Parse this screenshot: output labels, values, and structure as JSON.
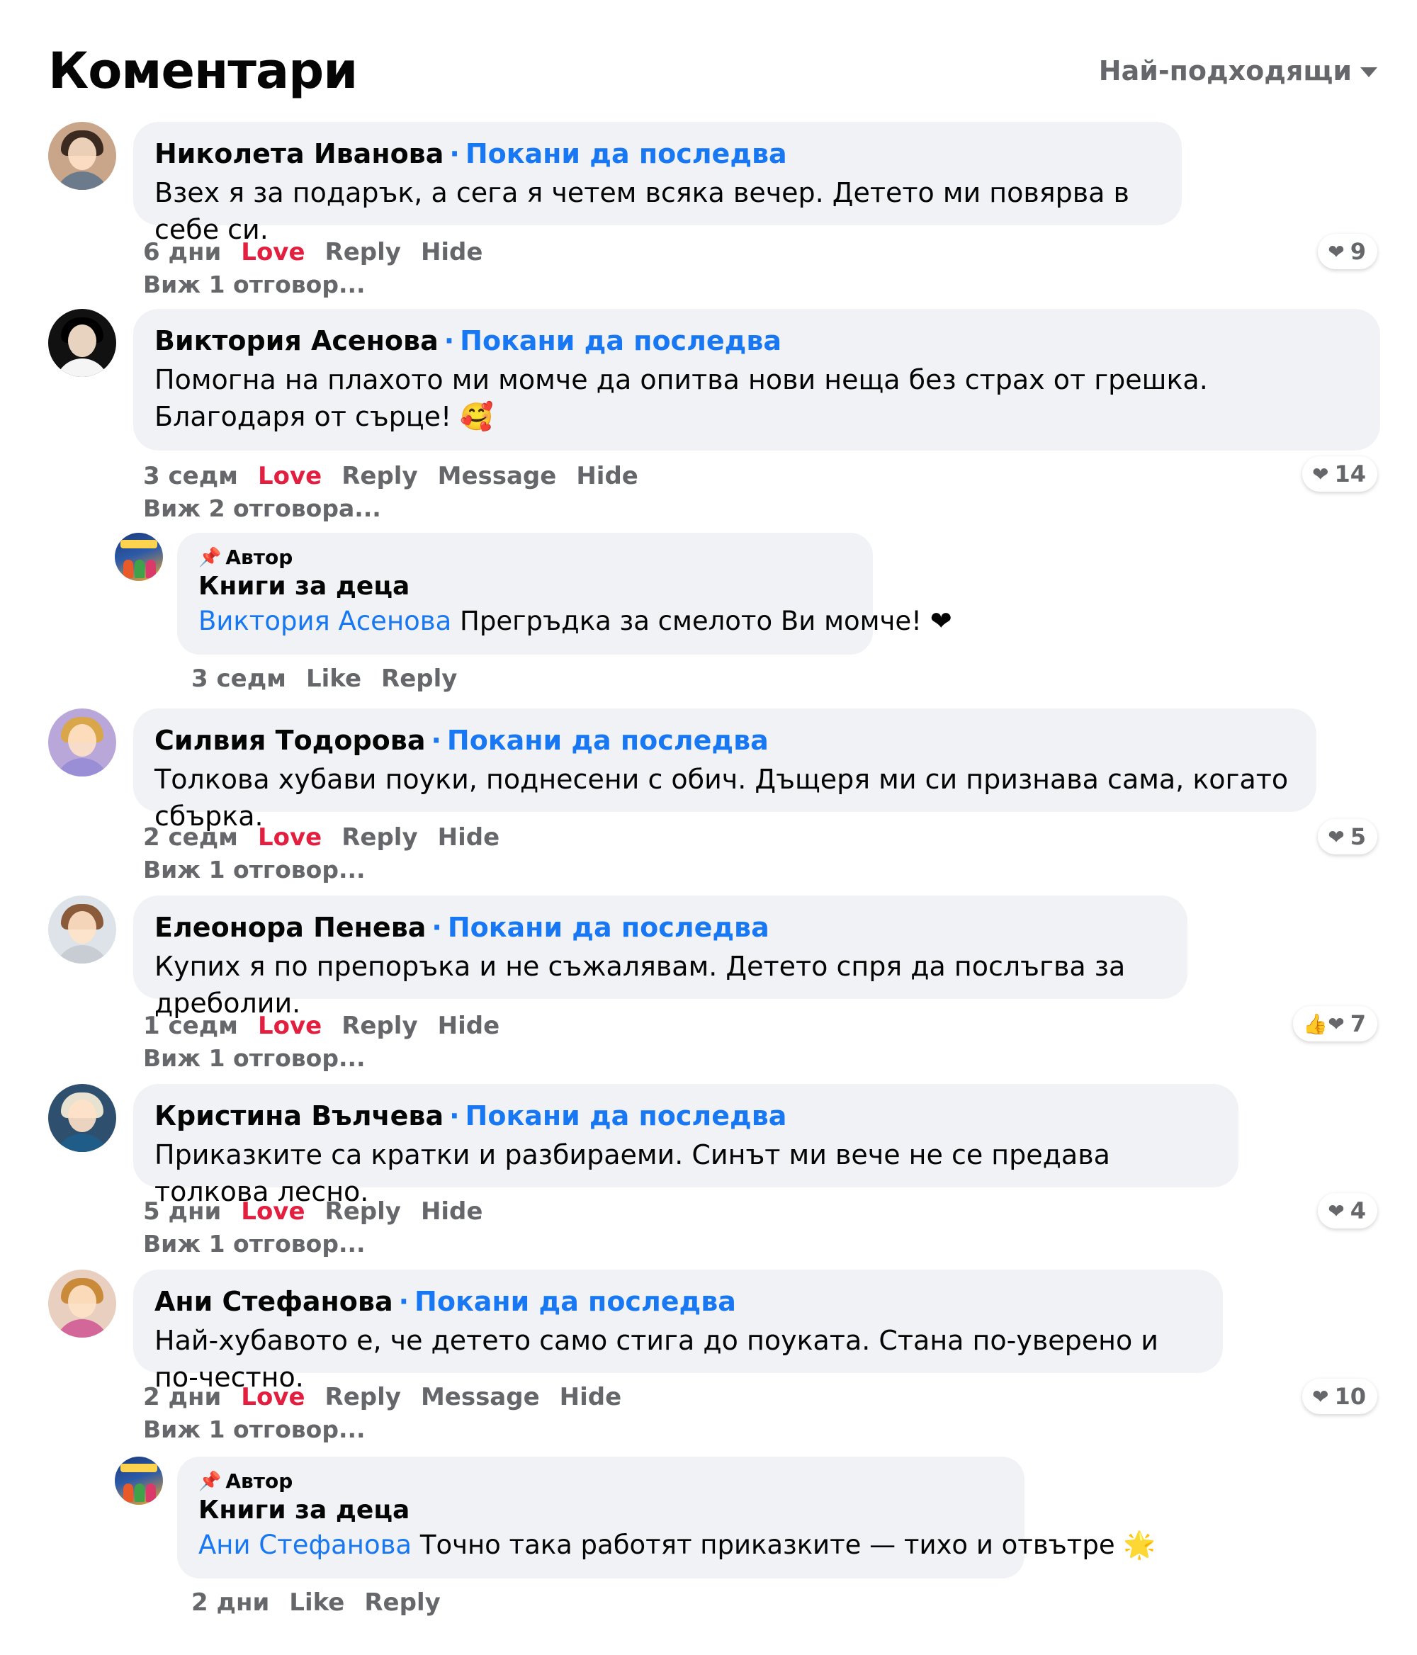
{
  "header": {
    "title": "Коментари",
    "sort_label": "Най-подходящи"
  },
  "labels": {
    "follow": "Покани да последва",
    "love": "Love",
    "reply": "Reply",
    "hide": "Hide",
    "message": "Message",
    "like": "Like",
    "author_badge": "Автор",
    "page_name": "Книги за деца"
  },
  "comments": [
    {
      "name": "Николета Иванова",
      "text": "Взех я за подарък, а сега я четем всяка вечер. Детето ми повярва в себе си.",
      "time": "6 дни",
      "more": "Виж 1 отговор...",
      "reactions": "9",
      "reaction_icons": "❤"
    },
    {
      "name": "Виктория Асенова",
      "text": "Помогна на плахото ми момче да опитва нови неща без страх от грешка. Благодаря от сърце! 🥰",
      "time": "3 седм",
      "more": "Виж 2 отговора...",
      "reactions": "14",
      "reaction_icons": "❤"
    },
    {
      "name": "Силвия Тодорова",
      "text": "Толкова хубави поуки, поднесени с обич. Дъщеря ми си признава сама, когато сбърка.",
      "time": "2 седм",
      "more": "Виж 1 отговор...",
      "reactions": "5",
      "reaction_icons": "❤"
    },
    {
      "name": "Елеонора Пенева",
      "text": "Купих я по препоръка и не съжалявам. Детето спря да послъгва за дреболии.",
      "time": "1 седм",
      "more": "Виж 1 отговор...",
      "reactions": "7",
      "reaction_icons": "👍❤"
    },
    {
      "name": "Кристина Вълчева",
      "text": "Приказките са кратки и разбираеми. Синът ми вече не се предава толкова лесно.",
      "time": "5 дни",
      "more": "Виж 1 отговор...",
      "reactions": "4",
      "reaction_icons": "❤"
    },
    {
      "name": "Ани Стефанова",
      "text": "Най-хубавото е, че детето само стига до поуката. Стана по-уверено и по-честно.",
      "time": "2 дни",
      "more": "Виж 1 отговор...",
      "reactions": "10",
      "reaction_icons": "❤"
    }
  ],
  "replies": [
    {
      "mention": "Виктория Асенова",
      "text": "Прегръдка за смелото Ви момче! ❤",
      "time": "3 седм"
    },
    {
      "mention": "Ани Стефанова",
      "text": "Точно така работят приказките — тихо и отвътре 🌟",
      "time": "2 дни"
    }
  ],
  "colors": {
    "link": "#1877f2",
    "love": "#e41e3f",
    "muted": "#65676b",
    "bubble": "#f0f2f5"
  }
}
